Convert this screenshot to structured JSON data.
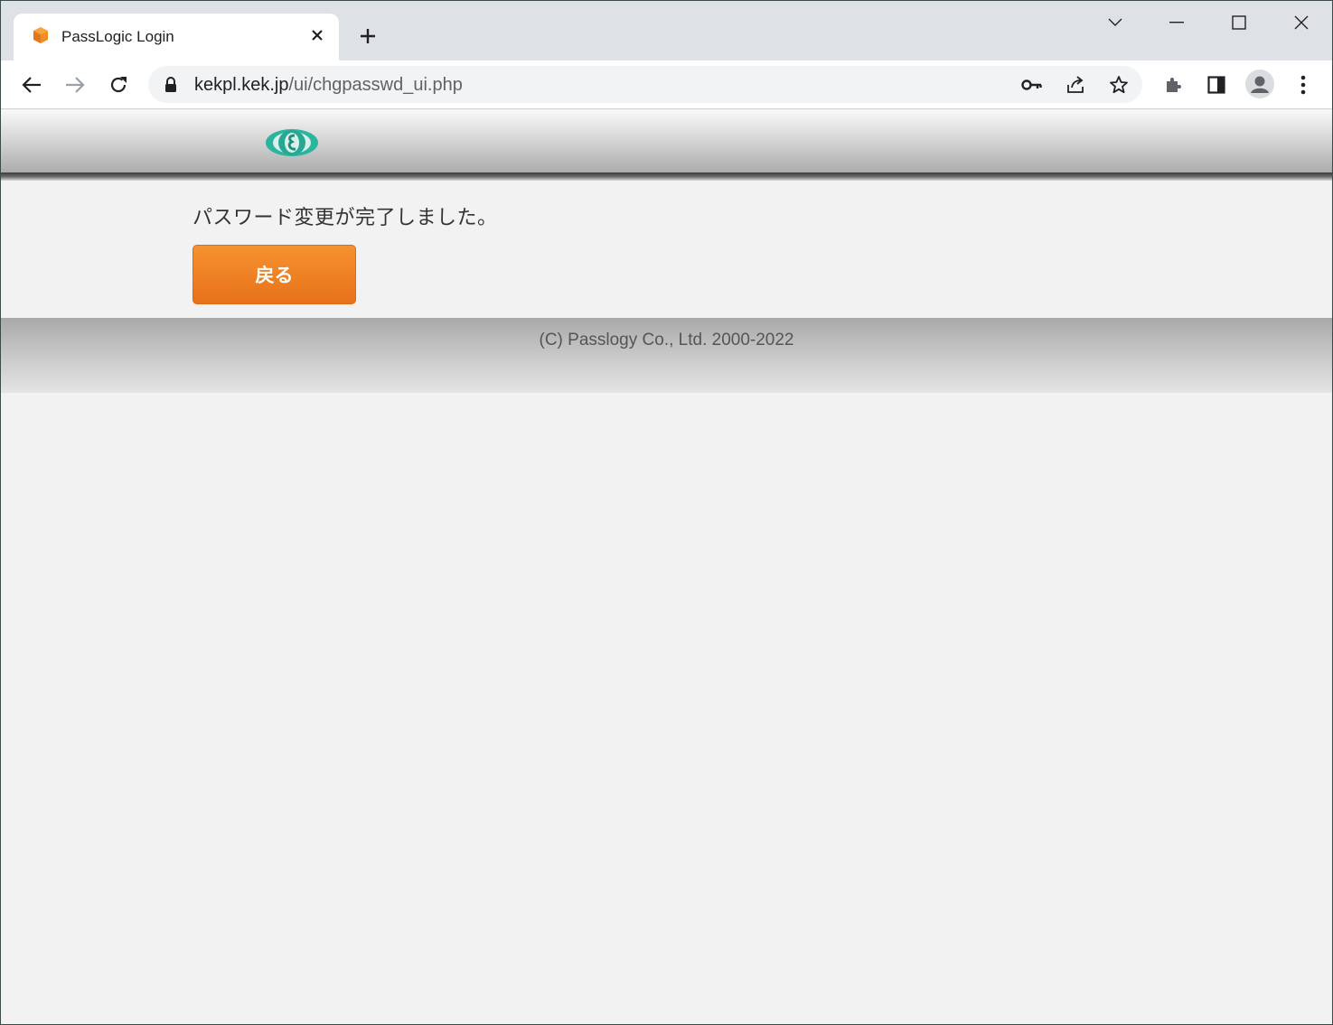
{
  "browser": {
    "tab": {
      "title": "PassLogic Login",
      "favicon": "passlogic-cube-icon"
    },
    "new_tab_icon": "plus-icon",
    "window_controls": [
      "tab-search-icon",
      "minimize-icon",
      "maximize-icon",
      "close-icon"
    ],
    "toolbar": {
      "back_icon": "arrow-left-icon",
      "forward_icon": "arrow-right-icon",
      "reload_icon": "reload-icon",
      "url_host": "kekpl.kek.jp",
      "url_path": "/ui/chgpasswd_ui.php",
      "omnibox_icons": [
        "key-icon",
        "share-icon",
        "star-icon"
      ],
      "right_icons": [
        "extensions-icon",
        "side-panel-icon",
        "profile-avatar",
        "more-menu-icon"
      ]
    }
  },
  "page": {
    "message": "パスワード変更が完了しました。",
    "back_button_label": "戻る",
    "footer": {
      "copyright": "(C) Passlogy Co., Ltd. 2000-2022"
    }
  },
  "colors": {
    "accent_button": "#f08424",
    "page_background": "#f2f2f2",
    "logo": "#2bb5a0"
  }
}
